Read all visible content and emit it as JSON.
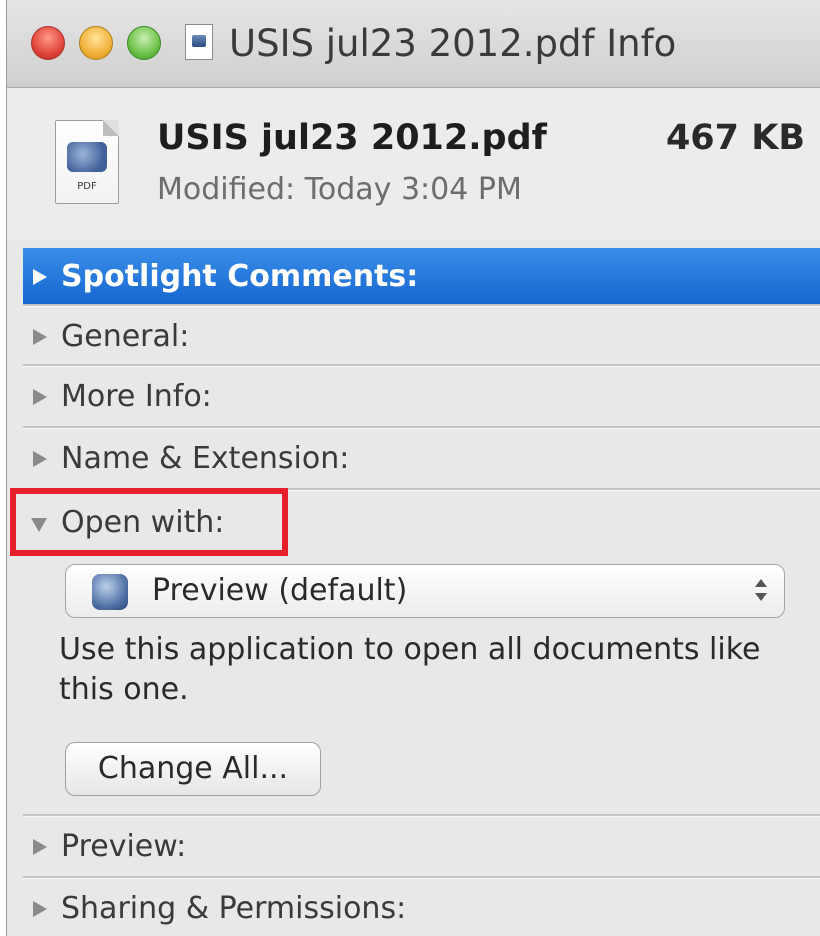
{
  "window": {
    "title": "USIS jul23 2012.pdf Info"
  },
  "header": {
    "file_name": "USIS jul23 2012.pdf",
    "file_size": "467 KB",
    "modified": "Modified: Today 3:04 PM",
    "icon_tag": "PDF"
  },
  "sections": {
    "spotlight": "Spotlight Comments:",
    "general": "General:",
    "more_info": "More Info:",
    "name_extension": "Name & Extension:",
    "open_with": "Open with:",
    "preview": "Preview:",
    "sharing": "Sharing & Permissions:"
  },
  "open_with": {
    "selected_app": "Preview (default)",
    "description": "Use this application to open all documents like this one.",
    "change_all_label": "Change All..."
  },
  "colors": {
    "selection": "#1565cf",
    "highlight_box": "#e5202c"
  }
}
